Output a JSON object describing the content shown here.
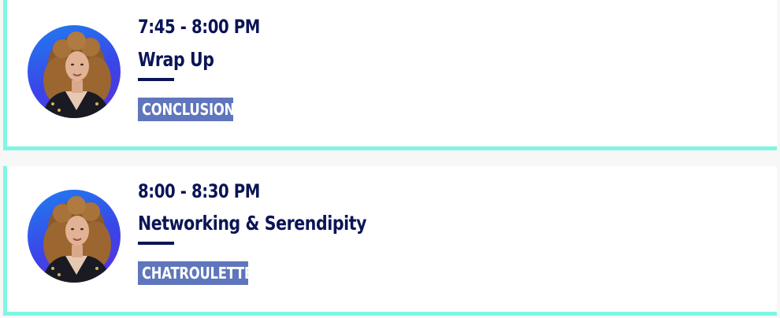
{
  "schedule": {
    "sessions": [
      {
        "time": "7:45 - 8:00 PM",
        "title": "Wrap Up",
        "tag": "CONCLUSION"
      },
      {
        "time": "8:00 - 8:30 PM",
        "title": "Networking & Serendipity",
        "tag": "CHATROULETTE"
      }
    ]
  },
  "colors": {
    "accent_border": "#7ff6e3",
    "heading_navy": "#0b1456",
    "tag_background": "#5f76bd",
    "avatar_gradient_start": "#1e7ff0",
    "avatar_gradient_end": "#5b2fdc",
    "page_background": "#f7f7f7"
  },
  "icons": {
    "avatar": "speaker-avatar-photo"
  }
}
